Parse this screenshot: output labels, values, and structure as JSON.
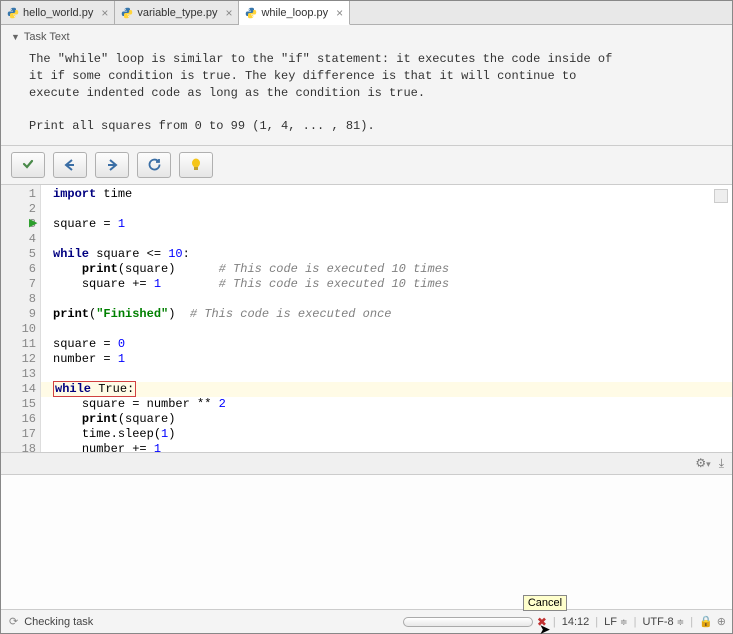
{
  "tabs": [
    {
      "label": "hello_world.py",
      "active": false
    },
    {
      "label": "variable_type.py",
      "active": false
    },
    {
      "label": "while_loop.py",
      "active": true
    }
  ],
  "task": {
    "header": "Task Text",
    "body": "The \"while\" loop is similar to the \"if\" statement: it executes the code inside of\nit if some condition is true. The key difference is that it will continue to\nexecute indented code as long as the condition is true.\n\nPrint all squares from 0 to 99 (1, 4, ... , 81)."
  },
  "toolbar": {
    "check": "check",
    "prev": "prev",
    "next": "next",
    "refresh": "refresh",
    "hint": "hint"
  },
  "code": {
    "lines": 18,
    "tokens": {
      "l1_kw": "import",
      "l1_mod": " time",
      "l3_a": "square = ",
      "l3_n": "1",
      "l5_kw": "while",
      "l5_a": " square <= ",
      "l5_n": "10",
      "l5_c": ":",
      "l6_fn": "print",
      "l6_a": "(square)",
      "l6_cm": "# This code is executed 10 times",
      "l7_a": "square += ",
      "l7_n": "1",
      "l7_cm": "# This code is executed 10 times",
      "l9_fn": "print",
      "l9_p": "(",
      "l9_s": "\"Finished\"",
      "l9_q": ")",
      "l9_sp": "  ",
      "l9_cm": "# This code is executed once",
      "l11_a": "square = ",
      "l11_n": "0",
      "l12_a": "number = ",
      "l12_n": "1",
      "l14_kw": "while",
      "l14_a": " True",
      "l14_c": ":",
      "l15_a": "square = number ** ",
      "l15_n": "2",
      "l16_fn": "print",
      "l16_a": "(square)",
      "l17_a": "time.sleep(",
      "l17_n": "1",
      "l17_b": ")",
      "l18_a": "number += ",
      "l18_n": "1"
    }
  },
  "status": {
    "task_label": "Checking task",
    "cancel_tooltip": "Cancel",
    "position": "14:12",
    "line_sep": "LF",
    "encoding": "UTF-8"
  }
}
